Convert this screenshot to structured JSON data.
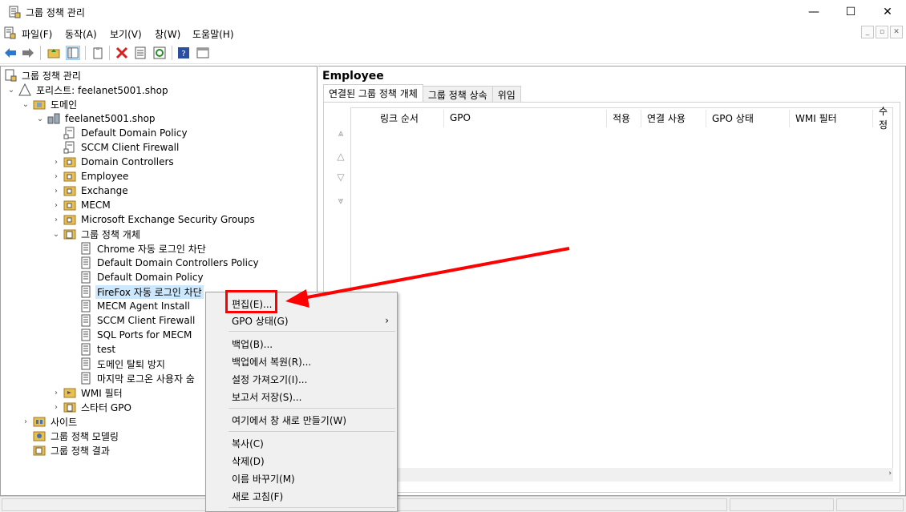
{
  "window": {
    "title": "그룹 정책 관리",
    "minimize": "—",
    "maximize": "☐",
    "close": "✕"
  },
  "menubar": {
    "items": [
      "파일(F)",
      "동작(A)",
      "보기(V)",
      "창(W)",
      "도움말(H)"
    ],
    "mdi": [
      "_",
      "▫",
      "✕"
    ]
  },
  "tree": {
    "root": "그룹 정책 관리",
    "forest": "포리스트: feelanet5001.shop",
    "domains": "도메인",
    "domain": "feelanet5001.shop",
    "items": [
      "Default Domain Policy",
      "SCCM Client Firewall",
      "Domain Controllers",
      "Employee",
      "Exchange",
      "MECM",
      "Microsoft Exchange Security Groups"
    ],
    "gpo_container": "그룹 정책 개체",
    "gpos": [
      "Chrome 자동 로그인 차단",
      "Default Domain Controllers Policy",
      "Default Domain Policy",
      "FireFox 자동 로그인 차단",
      "MECM Agent Install",
      "SCCM Client Firewall",
      "SQL Ports for MECM",
      "test",
      "도메인 탈퇴 방지",
      "마지막 로그온 사용자 숨"
    ],
    "wmi": "WMI 필터",
    "starter": "스타터 GPO",
    "sites": "사이트",
    "modeling": "그룹 정책 모델링",
    "results": "그룹 정책 결과"
  },
  "right": {
    "title": "Employee",
    "tabs": [
      "연결된 그룹 정책 개체",
      "그룹 정책 상속",
      "위임"
    ],
    "columns": [
      "링크 순서",
      "GPO",
      "적용",
      "연결 사용",
      "GPO 상태",
      "WMI 필터",
      "수정"
    ]
  },
  "context_menu": {
    "items": [
      {
        "label": "편집(E)...",
        "submenu": false
      },
      {
        "label": "GPO 상태(G)",
        "submenu": true
      },
      {
        "label": "백업(B)...",
        "submenu": false
      },
      {
        "label": "백업에서 복원(R)...",
        "submenu": false
      },
      {
        "label": "설정 가져오기(I)...",
        "submenu": false
      },
      {
        "label": "보고서 저장(S)...",
        "submenu": false
      },
      {
        "label": "여기에서 창 새로 만들기(W)",
        "submenu": false
      },
      {
        "label": "복사(C)",
        "submenu": false
      },
      {
        "label": "삭제(D)",
        "submenu": false
      },
      {
        "label": "이름 바꾸기(M)",
        "submenu": false
      },
      {
        "label": "새로 고침(F)",
        "submenu": false
      }
    ],
    "submenu_arrow": "›"
  },
  "colors": {
    "highlight": "#ff0000",
    "selection": "#cce8ff"
  },
  "icons": {
    "scroll_right": "›"
  }
}
